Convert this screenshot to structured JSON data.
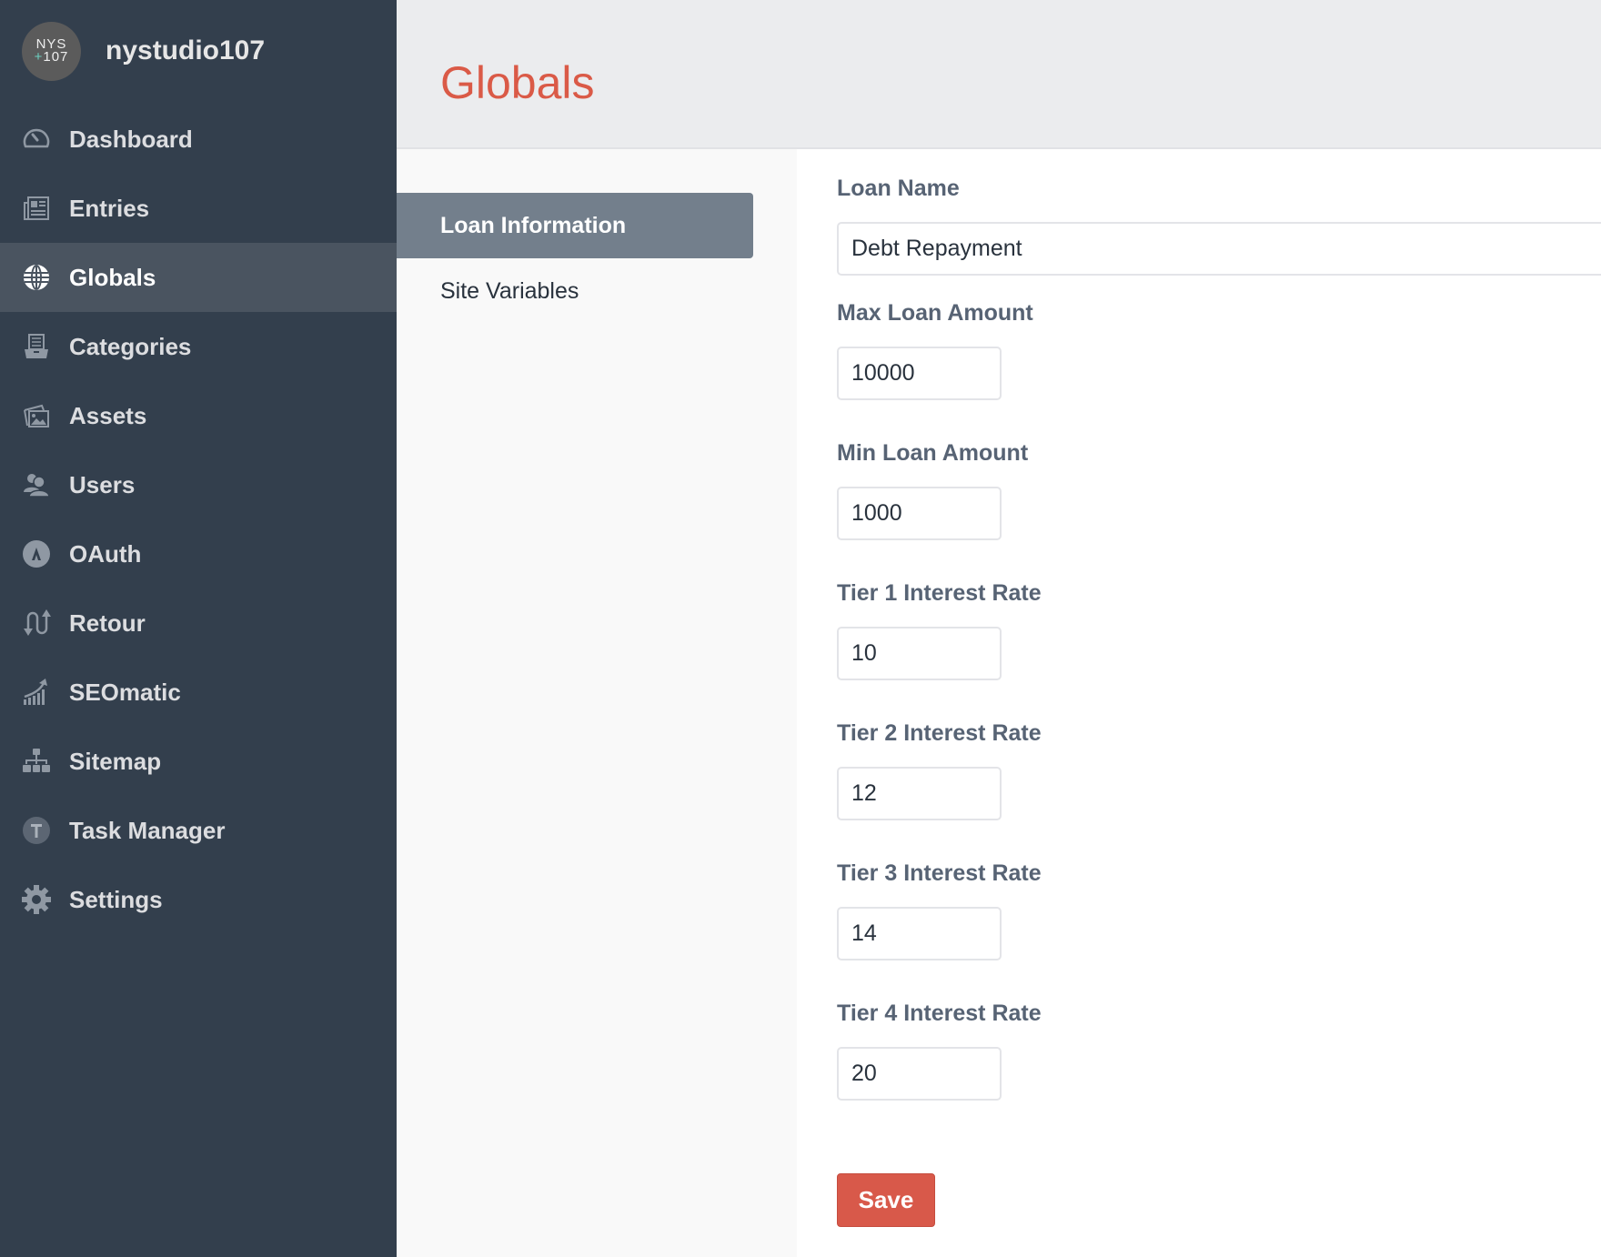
{
  "site": {
    "name": "nystudio107",
    "logo_line1": "NYS",
    "logo_plus": "+",
    "logo_line2": "107"
  },
  "sidebar": {
    "items": [
      {
        "label": "Dashboard",
        "icon": "dashboard-gauge-icon"
      },
      {
        "label": "Entries",
        "icon": "newspaper-icon"
      },
      {
        "label": "Globals",
        "icon": "globe-icon",
        "active": true
      },
      {
        "label": "Categories",
        "icon": "categories-tray-icon"
      },
      {
        "label": "Assets",
        "icon": "images-icon"
      },
      {
        "label": "Users",
        "icon": "users-icon"
      },
      {
        "label": "OAuth",
        "icon": "oauth-icon"
      },
      {
        "label": "Retour",
        "icon": "redirect-arrows-icon"
      },
      {
        "label": "SEOmatic",
        "icon": "growth-chart-icon"
      },
      {
        "label": "Sitemap",
        "icon": "sitemap-icon"
      },
      {
        "label": "Task Manager",
        "icon": "task-manager-icon"
      },
      {
        "label": "Settings",
        "icon": "gear-icon"
      }
    ]
  },
  "header": {
    "title": "Globals"
  },
  "subnav": {
    "items": [
      {
        "label": "Loan Information",
        "active": true
      },
      {
        "label": "Site Variables",
        "active": false
      }
    ]
  },
  "form": {
    "fields": [
      {
        "label": "Loan Name",
        "value": "Debt Repayment"
      },
      {
        "label": "Max Loan Amount",
        "value": "10000"
      },
      {
        "label": "Min Loan Amount",
        "value": "1000"
      },
      {
        "label": "Tier 1 Interest Rate",
        "value": "10"
      },
      {
        "label": "Tier 2 Interest Rate",
        "value": "12"
      },
      {
        "label": "Tier 3 Interest Rate",
        "value": "14"
      },
      {
        "label": "Tier 4 Interest Rate",
        "value": "20"
      }
    ],
    "save_label": "Save"
  },
  "colors": {
    "sidebar": "#333f4d",
    "sidebar_active": "#4a5460",
    "accent_red": "#da5a47",
    "subnav_active": "#737f8c",
    "label": "#576374"
  }
}
